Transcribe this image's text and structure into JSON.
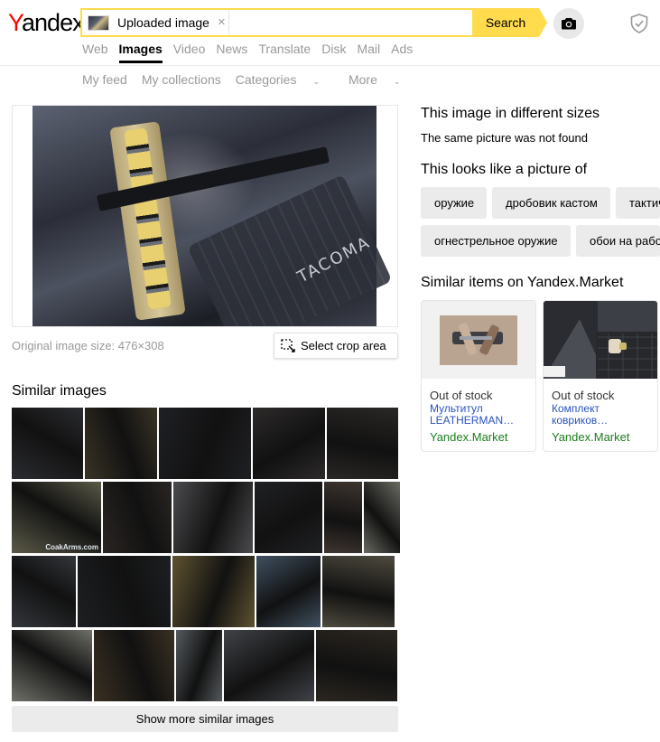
{
  "header": {
    "logo": "Yandex",
    "search": {
      "chip_label": "Uploaded image",
      "button_label": "Search",
      "value": ""
    },
    "nav_tabs": [
      {
        "label": "Web",
        "active": false
      },
      {
        "label": "Images",
        "active": true
      },
      {
        "label": "Video",
        "active": false
      },
      {
        "label": "News",
        "active": false
      },
      {
        "label": "Translate",
        "active": false
      },
      {
        "label": "Disk",
        "active": false
      },
      {
        "label": "Mail",
        "active": false
      },
      {
        "label": "Ads",
        "active": false
      }
    ],
    "sub_nav": {
      "feed": "My feed",
      "collections": "My collections",
      "categories": "Categories",
      "more": "More"
    }
  },
  "left": {
    "main_image_text": "TACOMA",
    "original_size": "Original image size: 476×308",
    "crop_button": "Select crop area",
    "similar_title": "Similar images",
    "similar_rows": [
      {
        "count": 5,
        "colors": [
          "#2b2c30",
          "#3a3326",
          "#1f2024",
          "#2d2a2a",
          "#2a2725"
        ]
      },
      {
        "count": 6,
        "colors": [
          "#5b5a48",
          "#2a2522",
          "#4b4a4d",
          "#202124",
          "#3e3530",
          "#6a6b62"
        ]
      },
      {
        "count": 5,
        "colors": [
          "#33363b",
          "#1d1f22",
          "#5e5230",
          "#3f5060",
          "#4e4a3e"
        ]
      },
      {
        "count": 5,
        "colors": [
          "#6f7068",
          "#3a3022",
          "#555a5e",
          "#404247",
          "#2b2620"
        ]
      }
    ],
    "thumb_overlay_text": "CoakArms.com",
    "show_more": "Show more similar images"
  },
  "right": {
    "sizes_title": "This image in different sizes",
    "sizes_text": "The same picture was not found",
    "looks_like_title": "This looks like a picture of",
    "tags": [
      "оружие",
      "дробовик кастом",
      "тактическое",
      "огнестрельное оружие",
      "обои на рабочий стол"
    ],
    "market_title": "Similar items on Yandex.Market",
    "market_items": [
      {
        "stock": "Out of stock",
        "name_line1": "Мультитул",
        "name_line2": "LEATHERMAN…",
        "shop": "Yandex.Market"
      },
      {
        "stock": "Out of stock",
        "name_line1": "Комплект",
        "name_line2": "ковриков…",
        "shop": "Yandex.Market"
      }
    ]
  },
  "colors": {
    "accent": "#ffdb4d",
    "logo_red": "#ff0000",
    "link_blue": "#2a52be",
    "market_green": "#1e7d1e",
    "muted_text": "#999999"
  },
  "icons": {
    "camera": "camera-icon",
    "shield": "shield-icon",
    "crop": "crop-icon",
    "close": "close-icon"
  }
}
